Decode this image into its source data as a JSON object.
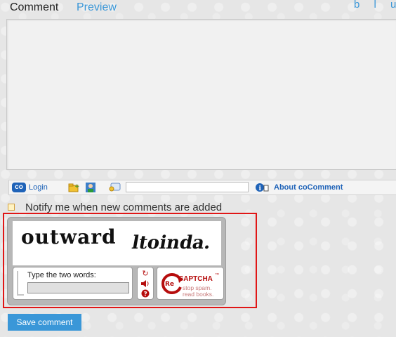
{
  "tabs": {
    "comment": "Comment",
    "preview": "Preview"
  },
  "corner_text": "b l u",
  "cocomment_bar": {
    "login_label": "Login",
    "logo_text": "co",
    "about_label": "About coComment",
    "input_value": ""
  },
  "notify_label": "Notify me when new comments are added",
  "recaptcha": {
    "word1": "outward",
    "word2": "ltoinda.",
    "prompt": "Type the two words:",
    "response_value": "",
    "brand_prefix": "Re",
    "brand_name": "CAPTCHA",
    "brand_tm": "™",
    "tagline1": "stop spam.",
    "tagline2": "read books.",
    "colors": {
      "accent": "#b60d0d"
    }
  },
  "save_button_label": "Save comment",
  "colors": {
    "link": "#3a97d8",
    "frame": "#e01616"
  }
}
